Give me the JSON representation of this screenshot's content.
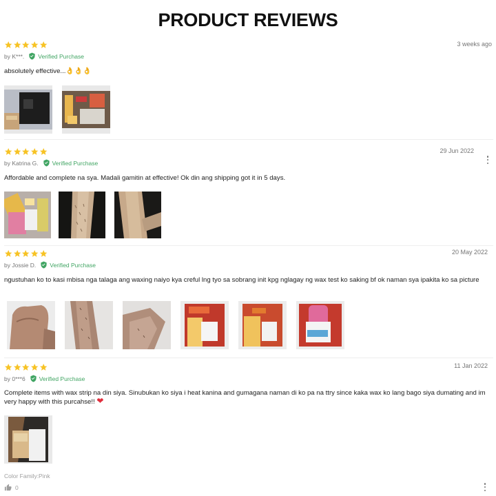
{
  "page": {
    "title": "PRODUCT REVIEWS"
  },
  "colors": {
    "star": "#f7c325",
    "verified": "#41a563",
    "heart": "#e02d3c",
    "muted": "#757575"
  },
  "reviews": [
    {
      "rating": 5,
      "date": "3 weeks ago",
      "author": "by K***.",
      "verified": "Verified Purchase",
      "text": "absolutely effective...",
      "emoji": "👌👌👌",
      "images": [
        "photo-wax-kit-box",
        "photo-wax-kit-contents"
      ]
    },
    {
      "rating": 5,
      "date": "29 Jun 2022",
      "author": "by Katrina G.",
      "verified": "Verified Purchase",
      "text": "Affordable and complete na sya. Madali gamitin at effective! Ok din ang shipping got it in 5 days.",
      "images": [
        "photo-wax-kit-items",
        "photo-leg-before",
        "photo-leg-after"
      ]
    },
    {
      "rating": 5,
      "date": "20 May 2022",
      "author": "by Jossie D.",
      "verified": "Verified Purchase",
      "text": "ngustuhan ko to kasi mbisa nga talaga ang waxing naiyo kya creful lng tyo sa sobrang init kpg nglagay ng wax test ko saking bf ok naman sya ipakita ko sa picture",
      "images": [
        "photo-hand",
        "photo-arm-1",
        "photo-arm-2",
        "photo-wax-package-1",
        "photo-wax-package-2",
        "photo-wax-roller"
      ]
    },
    {
      "rating": 5,
      "date": "11 Jan 2022",
      "author": "by 0***6",
      "verified": "Verified Purchase",
      "text": "Complete items with wax strip na din siya. Sinubukan ko siya i heat kanina and gumagana naman di ko pa na ttry since kaka wax ko lang bago siya dumating and im very happy with this purcahse!!",
      "heart": "❤",
      "images": [
        "photo-wax-set"
      ],
      "sku": "Color Family:Pink",
      "likes": "0"
    }
  ]
}
